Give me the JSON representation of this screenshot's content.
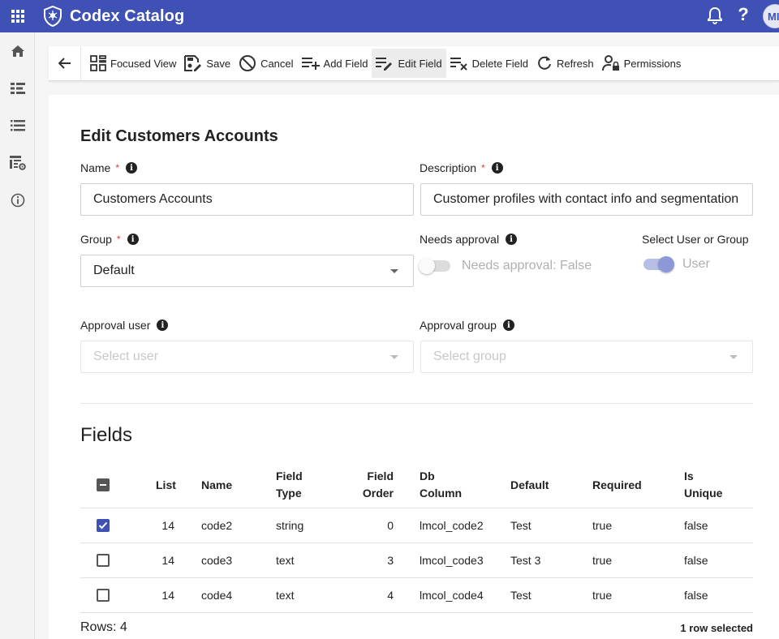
{
  "app": {
    "title": "Codex Catalog",
    "avatar_initials": "MI",
    "accent_color": "#3f51b5"
  },
  "rail": {
    "items": [
      {
        "icon": "home-icon"
      },
      {
        "icon": "catalog-list-icon"
      },
      {
        "icon": "list-icon"
      },
      {
        "icon": "table-settings-icon"
      },
      {
        "icon": "info-icon"
      }
    ]
  },
  "toolbar": {
    "focused_view": "Focused View",
    "save": "Save",
    "cancel": "Cancel",
    "add_field": "Add Field",
    "edit_field": "Edit Field",
    "delete_field": "Delete Field",
    "refresh": "Refresh",
    "permissions": "Permissions"
  },
  "form": {
    "title": "Edit Customers Accounts",
    "name_label": "Name",
    "name_value": "Customers Accounts",
    "description_label": "Description",
    "description_value": "Customer profiles with contact info and segmentation",
    "group_label": "Group",
    "group_value": "Default",
    "needs_approval_label": "Needs approval",
    "needs_approval_toggle_text": "Needs approval: False",
    "select_user_or_group_label": "Select User or Group",
    "user_toggle_text": "User",
    "approval_user_label": "Approval user",
    "approval_user_placeholder": "Select user",
    "approval_group_label": "Approval group",
    "approval_group_placeholder": "Select group"
  },
  "fields_section": {
    "title": "Fields",
    "columns": {
      "list": "List",
      "name": "Name",
      "field_type_1": "Field",
      "field_type_2": "Type",
      "field_order_1": "Field",
      "field_order_2": "Order",
      "db_column_1": "Db",
      "db_column_2": "Column",
      "default": "Default",
      "required": "Required",
      "is_unique_1": "Is",
      "is_unique_2": "Unique"
    },
    "rows": [
      {
        "selected": true,
        "list": "14",
        "name": "code2",
        "field_type": "string",
        "field_order": "0",
        "db_column": "lmcol_code2",
        "default": "Test",
        "required": "true",
        "is_unique": "false"
      },
      {
        "selected": false,
        "list": "14",
        "name": "code3",
        "field_type": "text",
        "field_order": "3",
        "db_column": "lmcol_code3",
        "default": "Test 3",
        "required": "true",
        "is_unique": "false"
      },
      {
        "selected": false,
        "list": "14",
        "name": "code4",
        "field_type": "text",
        "field_order": "4",
        "db_column": "lmcol_code4",
        "default": "Test",
        "required": "true",
        "is_unique": "false"
      }
    ],
    "rows_count": "Rows: 4",
    "selection_text": "1 row selected"
  }
}
